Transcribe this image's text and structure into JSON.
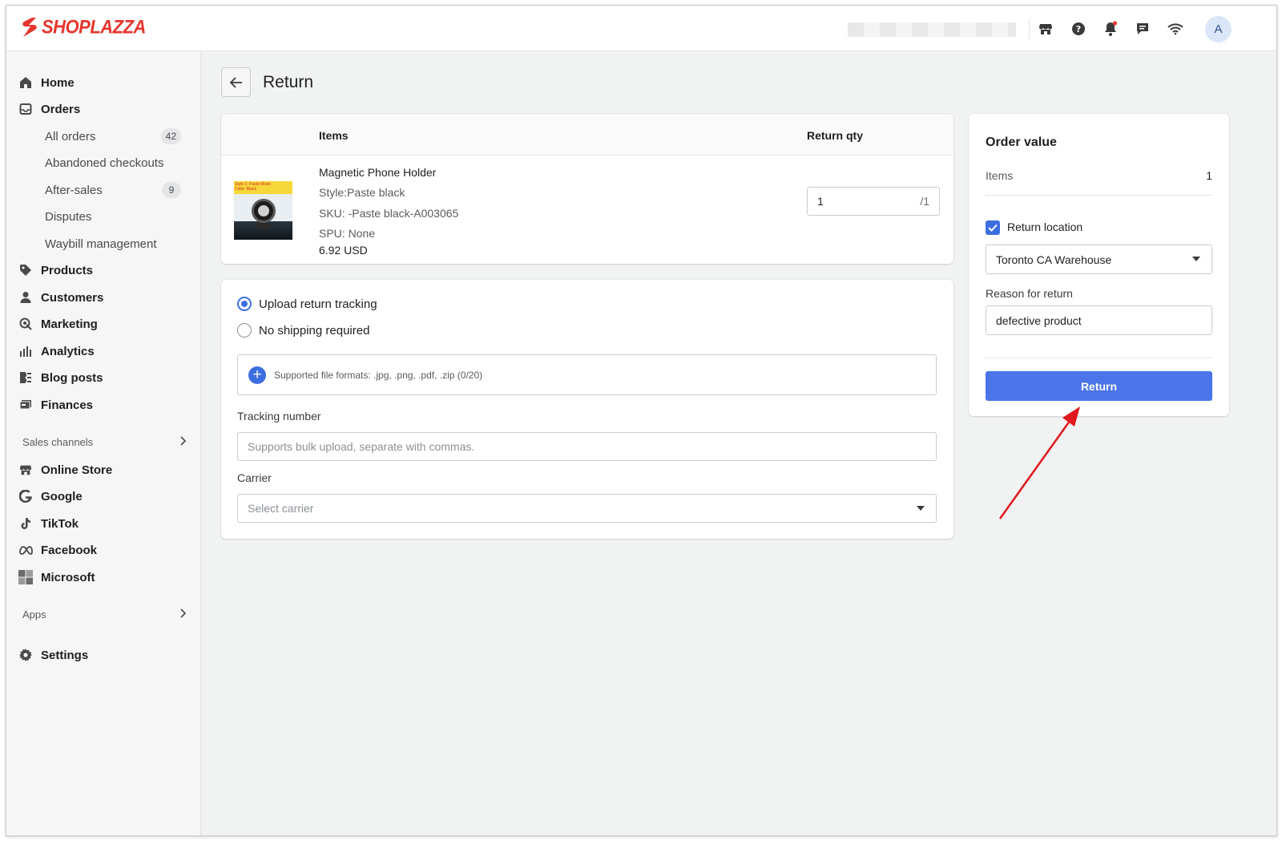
{
  "brand": {
    "name": "SHOPLAZZA",
    "color": "#e5362e"
  },
  "topbar": {
    "icons": [
      "store-icon",
      "help-icon",
      "bell-icon",
      "chat-icon",
      "wifi-icon"
    ],
    "avatar_initial": "A"
  },
  "sidebar": {
    "items": [
      {
        "label": "Home",
        "icon": "home-icon"
      },
      {
        "label": "Orders",
        "icon": "orders-icon"
      }
    ],
    "order_subitems": [
      {
        "label": "All orders",
        "count": "42"
      },
      {
        "label": "Abandoned checkouts",
        "count": null
      },
      {
        "label": "After-sales",
        "count": "9"
      },
      {
        "label": "Disputes",
        "count": null
      },
      {
        "label": "Waybill management",
        "count": null
      }
    ],
    "main_items": [
      {
        "label": "Products",
        "icon": "tag-icon"
      },
      {
        "label": "Customers",
        "icon": "person-icon"
      },
      {
        "label": "Marketing",
        "icon": "marketing-icon"
      },
      {
        "label": "Analytics",
        "icon": "bar-chart-icon"
      },
      {
        "label": "Blog posts",
        "icon": "blog-icon"
      },
      {
        "label": "Finances",
        "icon": "finance-icon"
      }
    ],
    "sales_channels_label": "Sales channels",
    "channels": [
      {
        "label": "Online Store",
        "icon": "store-icon"
      },
      {
        "label": "Google",
        "icon": "google-icon"
      },
      {
        "label": "TikTok",
        "icon": "tiktok-icon"
      },
      {
        "label": "Facebook",
        "icon": "meta-icon"
      },
      {
        "label": "Microsoft",
        "icon": "microsoft-icon"
      }
    ],
    "apps_label": "Apps",
    "settings_label": "Settings"
  },
  "page": {
    "title": "Return"
  },
  "items_table": {
    "col_items": "Items",
    "col_return_qty": "Return qty",
    "product": {
      "name": "Magnetic Phone Holder",
      "style": "Style:Paste black",
      "sku": "SKU: -Paste black-A003065",
      "spu": "SPU: None",
      "price": "6.92 USD",
      "thumb_text_1": "Style 1: Paste Mode",
      "thumb_text_2": "Color: Black"
    },
    "qty_value": "1",
    "qty_max": "/1"
  },
  "shipping": {
    "option_upload": "Upload return tracking",
    "option_none": "No shipping required",
    "selected": "upload",
    "upload_hint": "Supported file formats: .jpg, .png, .pdf, .zip (0/20)",
    "tracking_label": "Tracking number",
    "tracking_placeholder": "Supports bulk upload, separate with commas.",
    "carrier_label": "Carrier",
    "carrier_placeholder": "Select carrier"
  },
  "order_value": {
    "title": "Order value",
    "items_label": "Items",
    "items_count": "1",
    "return_location_label": "Return location",
    "return_location_checked": true,
    "return_location_value": "Toronto CA Warehouse",
    "reason_label": "Reason for return",
    "reason_value": "defective product",
    "return_button": "Return"
  },
  "colors": {
    "accent": "#4a74e8",
    "annotation_arrow": "#e0191e"
  }
}
